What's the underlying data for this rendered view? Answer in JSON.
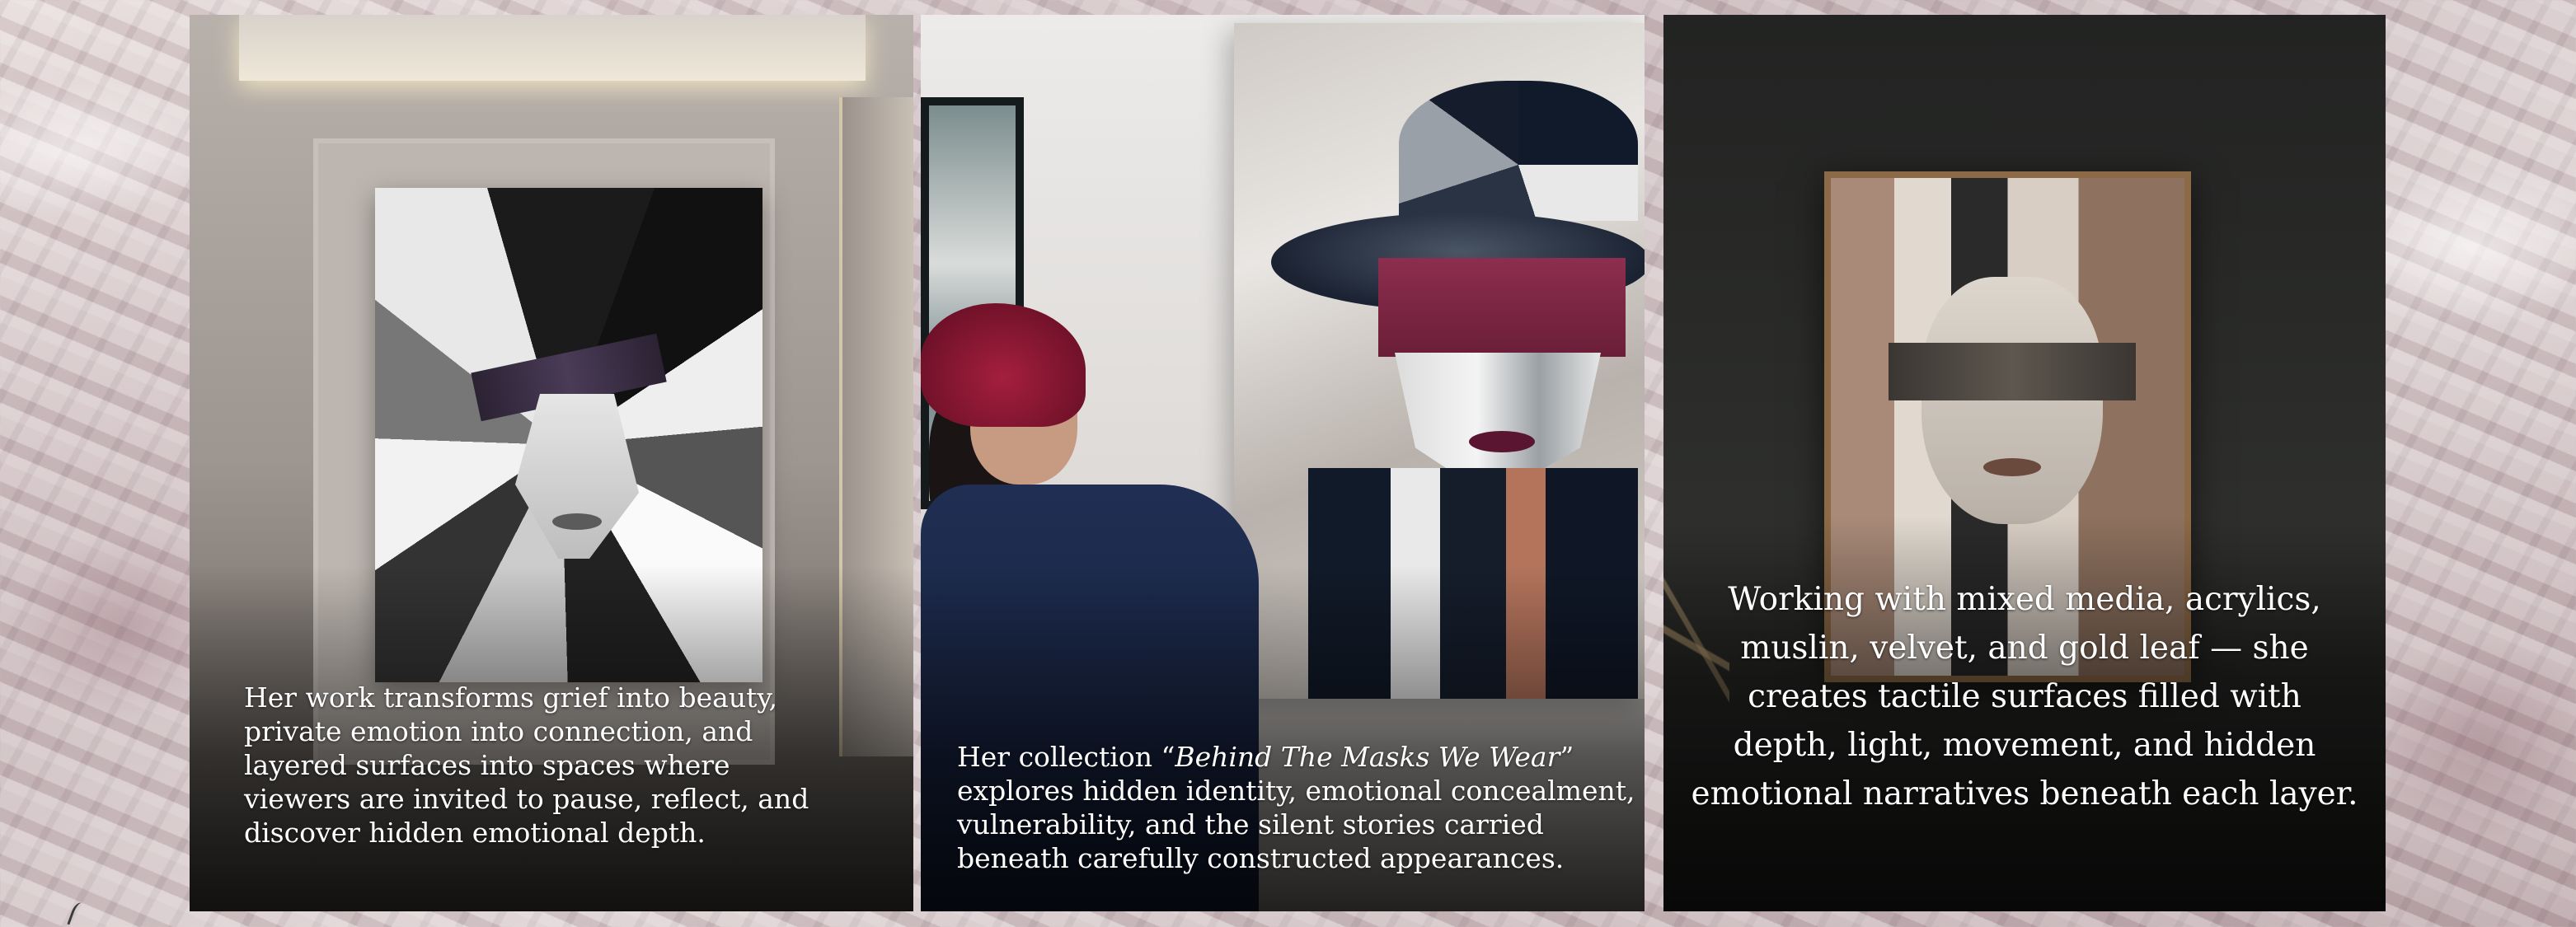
{
  "panels": [
    {
      "caption_lines": [
        "Her work transforms grief into beauty,",
        "private emotion into connection, and",
        "layered surfaces into spaces where",
        "viewers are invited to pause, reflect, and",
        "discover hidden emotional depth."
      ]
    },
    {
      "caption_prefix": "Her collection “",
      "caption_title": "Behind The Masks We Wear",
      "caption_suffix": "”",
      "caption_lines": [
        "explores hidden identity, emotional concealment,",
        "vulnerability, and the silent stories carried",
        "beneath carefully constructed appearances."
      ]
    },
    {
      "caption_lines": [
        "Working with mixed media, acrylics,",
        "muslin, velvet, and gold leaf — she",
        "creates tactile surfaces filled with",
        "depth, light, movement, and hidden",
        "emotional narratives beneath each layer."
      ]
    }
  ],
  "colors": {
    "background": "#d4c6c8",
    "caption_text": "#ffffff",
    "accent_burgundy": "#8d2e4e"
  }
}
